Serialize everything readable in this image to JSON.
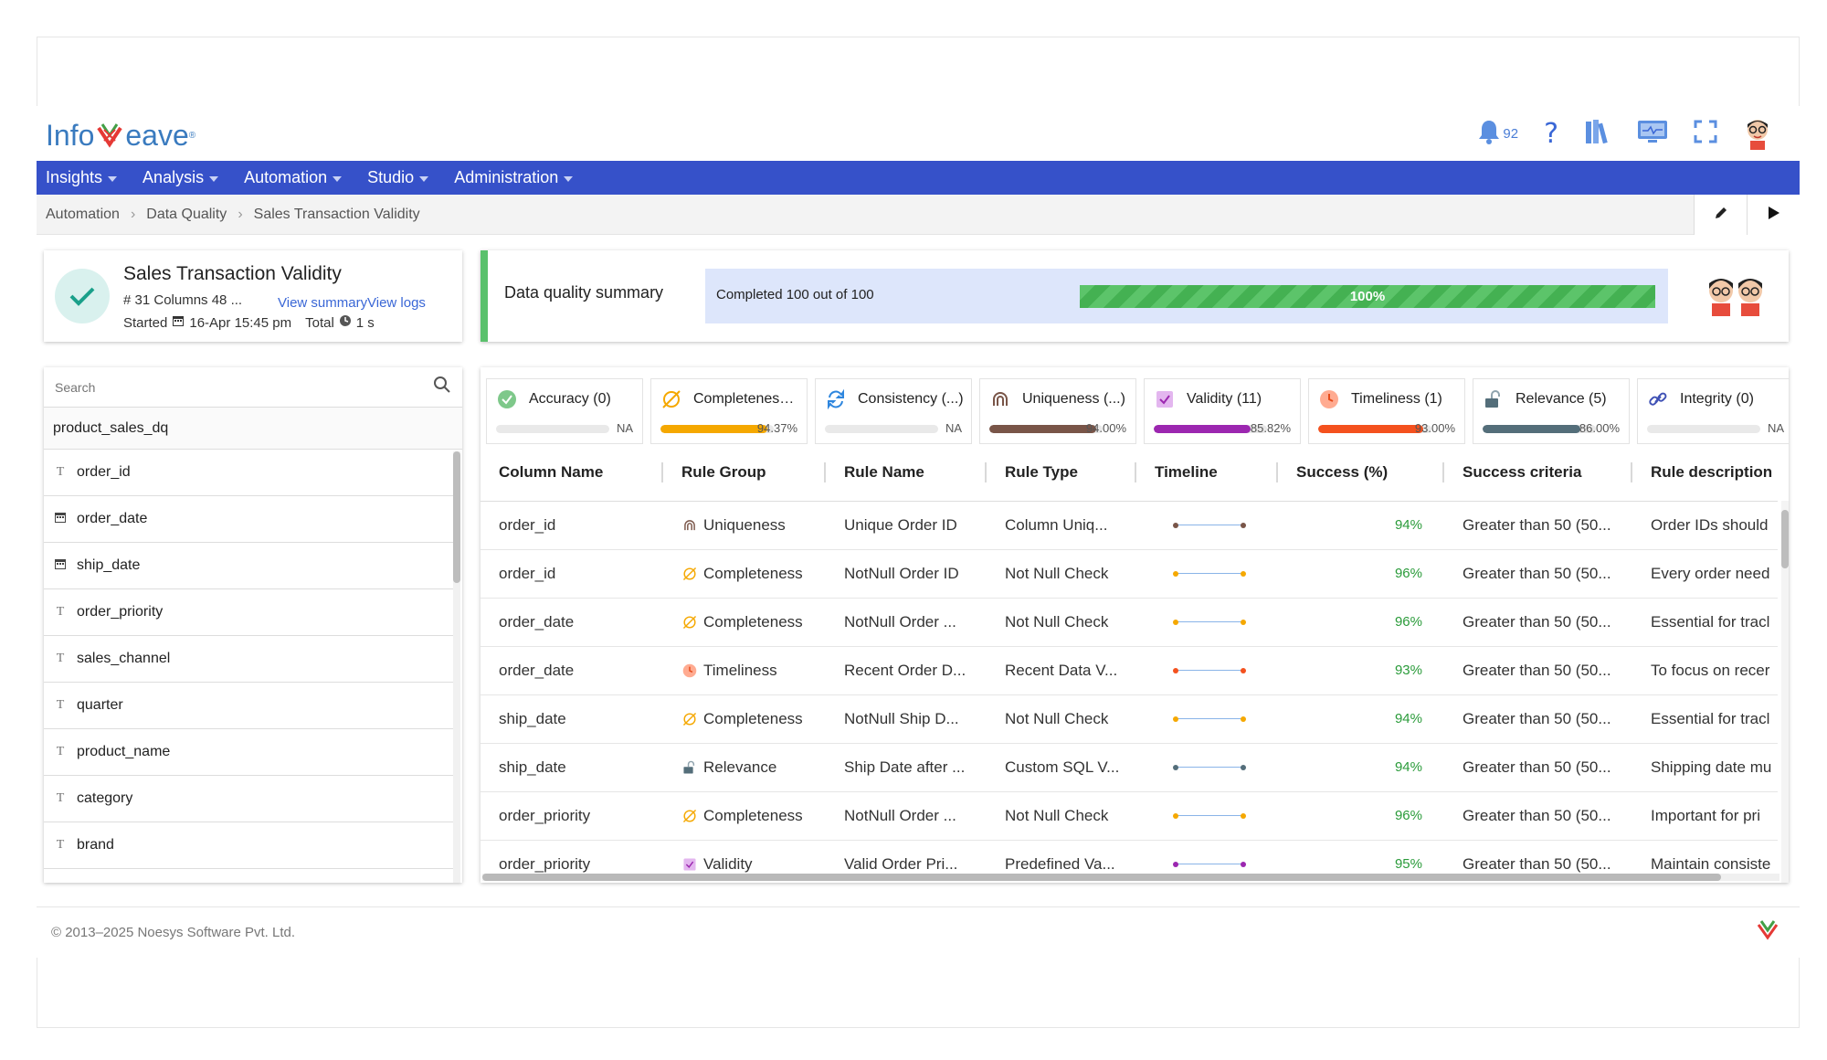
{
  "header": {
    "logo_text_left": "Info",
    "logo_text_right": "eave",
    "logo_registered": "®",
    "notification_count": "92",
    "icons": [
      "bell-icon",
      "help-icon",
      "library-icon",
      "monitor-icon",
      "fullscreen-icon",
      "user-avatar"
    ]
  },
  "nav": {
    "items": [
      {
        "label": "Insights"
      },
      {
        "label": "Analysis"
      },
      {
        "label": "Automation"
      },
      {
        "label": "Studio"
      },
      {
        "label": "Administration"
      }
    ]
  },
  "breadcrumb": {
    "items": [
      "Automation",
      "Data Quality",
      "Sales Transaction Validity"
    ],
    "actions": [
      "edit-icon",
      "run-icon"
    ]
  },
  "job": {
    "title": "Sales Transaction Validity",
    "meta": "# 31 Columns 48 ...",
    "view_summary": "View summary",
    "view_logs": "View logs",
    "started_label": "Started",
    "started_value": "16-Apr 15:45 pm",
    "total_label": "Total",
    "total_value": "1 s"
  },
  "summary": {
    "title": "Data quality summary",
    "completed_text": "Completed 100 out of 100",
    "progress_label": "100%",
    "progress_fraction": 1.0
  },
  "columns_panel": {
    "search_placeholder": "Search",
    "table_name": "product_sales_dq",
    "items": [
      {
        "name": "order_id",
        "type": "text"
      },
      {
        "name": "order_date",
        "type": "date"
      },
      {
        "name": "ship_date",
        "type": "date"
      },
      {
        "name": "order_priority",
        "type": "text"
      },
      {
        "name": "sales_channel",
        "type": "text"
      },
      {
        "name": "quarter",
        "type": "text"
      },
      {
        "name": "product_name",
        "type": "text"
      },
      {
        "name": "category",
        "type": "text"
      },
      {
        "name": "brand",
        "type": "text"
      }
    ]
  },
  "dimensions": [
    {
      "label": "Accuracy (0)",
      "value": "NA",
      "fraction": 0,
      "color": "#9e9e9e",
      "icon": "accuracy-check-icon"
    },
    {
      "label": "Completeness (...)",
      "value": "94.37%",
      "fraction": 0.9437,
      "color": "#f5a800",
      "icon": "completeness-icon"
    },
    {
      "label": "Consistency (...)",
      "value": "NA",
      "fraction": 0,
      "color": "#2e86de",
      "icon": "consistency-icon"
    },
    {
      "label": "Uniqueness (...)",
      "value": "94.00%",
      "fraction": 0.94,
      "color": "#795548",
      "icon": "uniqueness-icon"
    },
    {
      "label": "Validity (11)",
      "value": "85.82%",
      "fraction": 0.8582,
      "color": "#9c27b0",
      "icon": "validity-icon"
    },
    {
      "label": "Timeliness (1)",
      "value": "93.00%",
      "fraction": 0.93,
      "color": "#f4511e",
      "icon": "timeliness-icon"
    },
    {
      "label": "Relevance (5)",
      "value": "86.00%",
      "fraction": 0.86,
      "color": "#546e7a",
      "icon": "relevance-icon"
    },
    {
      "label": "Integrity (0)",
      "value": "NA",
      "fraction": 0,
      "color": "#3f51b5",
      "icon": "integrity-icon"
    }
  ],
  "rules_table": {
    "headers": [
      "Column Name",
      "Rule Group",
      "Rule Name",
      "Rule Type",
      "Timeline",
      "Success (%)",
      "Success criteria",
      "Rule description"
    ],
    "rows": [
      {
        "column": "order_id",
        "group": "Uniqueness",
        "group_color": "#795548",
        "rule": "Unique Order ID",
        "type": "Column Uniq...",
        "success": "94%",
        "criteria": "Greater than 50 (50...",
        "description": "Order IDs should"
      },
      {
        "column": "order_id",
        "group": "Completeness",
        "group_color": "#f5a800",
        "rule": "NotNull Order ID",
        "type": "Not Null Check",
        "success": "96%",
        "criteria": "Greater than 50 (50...",
        "description": "Every order need"
      },
      {
        "column": "order_date",
        "group": "Completeness",
        "group_color": "#f5a800",
        "rule": "NotNull Order ...",
        "type": "Not Null Check",
        "success": "96%",
        "criteria": "Greater than 50 (50...",
        "description": "Essential for tracl"
      },
      {
        "column": "order_date",
        "group": "Timeliness",
        "group_color": "#f4511e",
        "rule": "Recent Order D...",
        "type": "Recent Data V...",
        "success": "93%",
        "criteria": "Greater than 50 (50...",
        "description": "To focus on recer"
      },
      {
        "column": "ship_date",
        "group": "Completeness",
        "group_color": "#f5a800",
        "rule": "NotNull Ship D...",
        "type": "Not Null Check",
        "success": "94%",
        "criteria": "Greater than 50 (50...",
        "description": "Essential for tracl"
      },
      {
        "column": "ship_date",
        "group": "Relevance",
        "group_color": "#546e7a",
        "rule": "Ship Date after ...",
        "type": "Custom SQL V...",
        "success": "94%",
        "criteria": "Greater than 50 (50...",
        "description": "Shipping date mu"
      },
      {
        "column": "order_priority",
        "group": "Completeness",
        "group_color": "#f5a800",
        "rule": "NotNull Order ...",
        "type": "Not Null Check",
        "success": "96%",
        "criteria": "Greater than 50 (50...",
        "description": "Important for pri"
      },
      {
        "column": "order_priority",
        "group": "Validity",
        "group_color": "#9c27b0",
        "rule": "Valid Order Pri...",
        "type": "Predefined Va...",
        "success": "95%",
        "criteria": "Greater than 50 (50...",
        "description": "Maintain consiste"
      }
    ]
  },
  "footer": {
    "copyright": "© 2013–2025 Noesys Software Pvt. Ltd."
  }
}
